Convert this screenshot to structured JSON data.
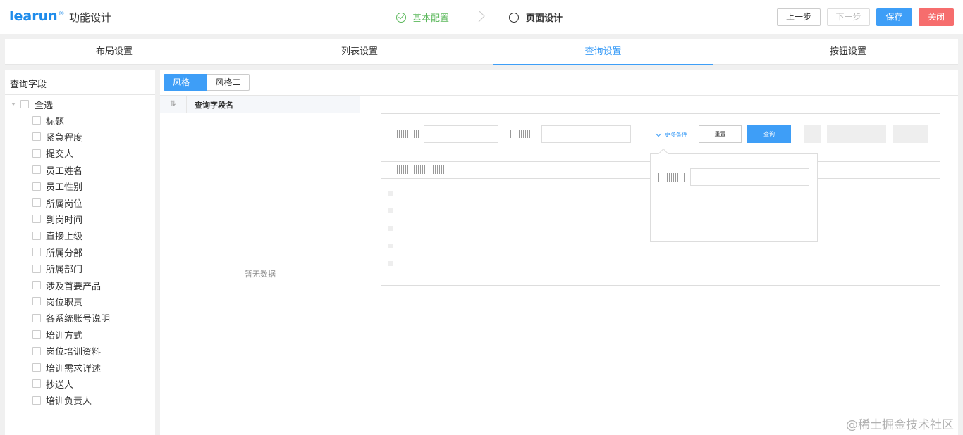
{
  "header": {
    "logo": "learun",
    "logo_mark": "®",
    "title": "功能设计",
    "steps": [
      {
        "label": "基本配置",
        "status": "done"
      },
      {
        "label": "页面设计",
        "status": "current"
      }
    ],
    "buttons": {
      "prev": "上一步",
      "next": "下一步",
      "save": "保存",
      "close": "关闭"
    }
  },
  "tabs": [
    {
      "label": "布局设置",
      "active": false
    },
    {
      "label": "列表设置",
      "active": false
    },
    {
      "label": "查询设置",
      "active": true
    },
    {
      "label": "按钮设置",
      "active": false
    }
  ],
  "left_panel": {
    "title": "查询字段",
    "select_all": "全选",
    "fields": [
      "标题",
      "紧急程度",
      "提交人",
      "员工姓名",
      "员工性别",
      "所属岗位",
      "到岗时间",
      "直接上级",
      "所属分部",
      "所属部门",
      "涉及首要产品",
      "岗位职责",
      "各系统账号说明",
      "培训方式",
      "岗位培训资料",
      "培训需求详述",
      "抄送人",
      "培训负责人"
    ]
  },
  "main": {
    "styles": [
      "风格一",
      "风格二"
    ],
    "active_style": "风格一",
    "table": {
      "column": "查询字段名",
      "empty": "暂无数据"
    },
    "preview": {
      "more": "更多条件",
      "reset": "重置",
      "query": "查询"
    }
  },
  "colors": {
    "accent": "#3e9ef7",
    "success": "#5cb85c",
    "danger": "#f66d6d",
    "brand": "#1f8ceb"
  },
  "watermark": "@稀土掘金技术社区"
}
